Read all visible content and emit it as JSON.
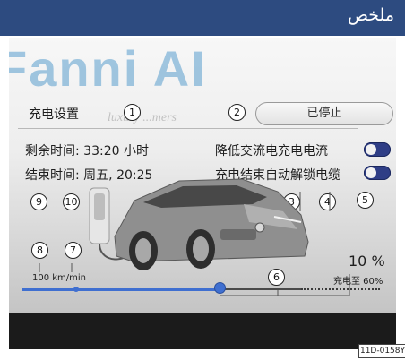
{
  "header": {
    "title": "ملخص"
  },
  "watermark": {
    "main": "Fanni AI",
    "sub": "luxury ...mers"
  },
  "screen": {
    "charge_settings_label": "充电设置",
    "stop_button_label": "已停止",
    "remaining_time": "剩余时间: 33:20 小时",
    "end_time": "结束时间: 周五, 20:25",
    "reduce_ac_current_label": "降低交流电充电电流",
    "auto_unlock_cable_label": "充电结束自动解锁电缆",
    "reduce_ac_current_on": true,
    "auto_unlock_cable_on": true,
    "charge_rate": "100 km/min",
    "current_level_label": "10 %",
    "charge_target_label": "充电至 60%"
  },
  "charge": {
    "current_level": 0.1,
    "target_level": 0.6
  },
  "callouts": [
    "1",
    "2",
    "3",
    "4",
    "5",
    "6",
    "7",
    "8",
    "9",
    "10"
  ],
  "figure_code": "11D-0158Y",
  "colors": {
    "banner": "#2d4b80",
    "accent": "#3f6fd0",
    "toggle": "#2f3e86",
    "watermark": "#2a84c2"
  }
}
